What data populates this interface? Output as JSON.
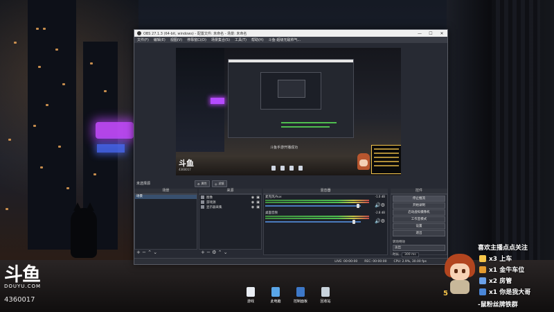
{
  "obs": {
    "title": "OBS 27.1.3 (64-bit, windows) - 配置文件: 未命名 - 场景: 未命名",
    "menu": [
      "文件(F)",
      "编辑(E)",
      "视图(V)",
      "停靠窗口(D)",
      "场景集合(S)",
      "工具(T)",
      "帮助(H)",
      "斗鱼-超级无敌帅气..."
    ],
    "preview_text": "斗鱼手游开播成功",
    "preview_watermark": "斗鱼",
    "preview_id": "4360017",
    "scene_label": "未选择源",
    "prop_button": "属性",
    "filter_button": "滤镜",
    "docks": {
      "scenes": "场景",
      "sources": "来源",
      "mixer": "混音器",
      "controls": "控件"
    },
    "scenes": [
      "场景"
    ],
    "sources": [
      "图像",
      "游戏源",
      "显示器采集"
    ],
    "mixer": [
      {
        "name": "麦克风/Aux",
        "db": "-1.0 dB",
        "level": 0.88
      },
      {
        "name": "桌面音频",
        "db": "-2.8 dB",
        "level": 0.76
      }
    ],
    "controls": [
      "停止推流",
      "开始录制",
      "启动虚拟摄像机",
      "工作室模式",
      "设置",
      "退出"
    ],
    "transition": {
      "label": "转场特效",
      "type": "淡出",
      "duration_label": "时长",
      "duration_value": "300 ms"
    },
    "footer_glyphs": {
      "scenes": "+ − ⌃ ⌄",
      "sources": "+ − ⚙ ⌃ ⌄"
    },
    "status": {
      "live": "LIVE: 00:00:00",
      "rec": "REC: 00:00:00",
      "cpu": "CPU: 2.9%, 30.00 fps"
    },
    "window_controls": [
      "—",
      "☐",
      "✕"
    ]
  },
  "desktop": {
    "watermark_logo": "斗鱼",
    "watermark_sub": "DOUYU.COM",
    "room_id": "4360017",
    "icons": [
      {
        "label": "游戏",
        "color": "#e9edf3"
      },
      {
        "label": "此电脑",
        "color": "#5aa6e8"
      },
      {
        "label": "控制面板",
        "color": "#3d78c8"
      },
      {
        "label": "回收站",
        "color": "#c9d3dc"
      }
    ]
  },
  "overlay": {
    "header": "喜欢主播点点关注",
    "rows": [
      {
        "text": "x3 上车",
        "color": "#f6c64a"
      },
      {
        "text": "x1 金牛车位",
        "color": "#e59b2f"
      },
      {
        "text": "x2 房管",
        "color": "#6aa0e8"
      },
      {
        "text": "x1 你是我大哥",
        "color": "#4a86d8"
      }
    ],
    "footer": "-鼠粉丝牌铁群",
    "number": "5"
  }
}
